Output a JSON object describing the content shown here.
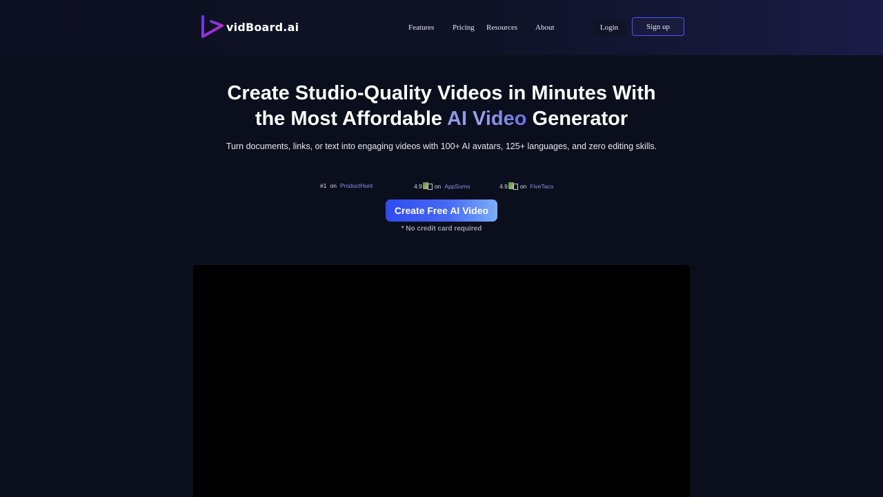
{
  "brand": {
    "name": "vidBoard.ai"
  },
  "nav": {
    "links": [
      "Features",
      "Pricing",
      "Resources",
      "About"
    ],
    "login": "Login",
    "signup": "Sign up"
  },
  "hero": {
    "title_line1": "Create Studio-Quality Videos in Minutes With",
    "title_line2_pre": "the Most Affordable ",
    "title_line2_accent": "AI Video",
    "title_line2_post": " Generator",
    "subtitle": "Turn documents, links, or text into engaging videos with 100+ AI avatars, 125+ languages, and zero editing skills."
  },
  "badges": [
    {
      "rank": "#1",
      "on": "on",
      "platform": "ProductHunt"
    },
    {
      "rank": "4.9",
      "on": "on",
      "platform": "AppSumo"
    },
    {
      "rank": "4.9",
      "on": "on",
      "platform": "FiveTaco"
    }
  ],
  "cta": {
    "label": "Create Free AI Video",
    "note": "* No credit card required"
  },
  "colors": {
    "background": "#0b0f1d",
    "accent": "#4b57ff",
    "link": "#8e8ff0"
  }
}
